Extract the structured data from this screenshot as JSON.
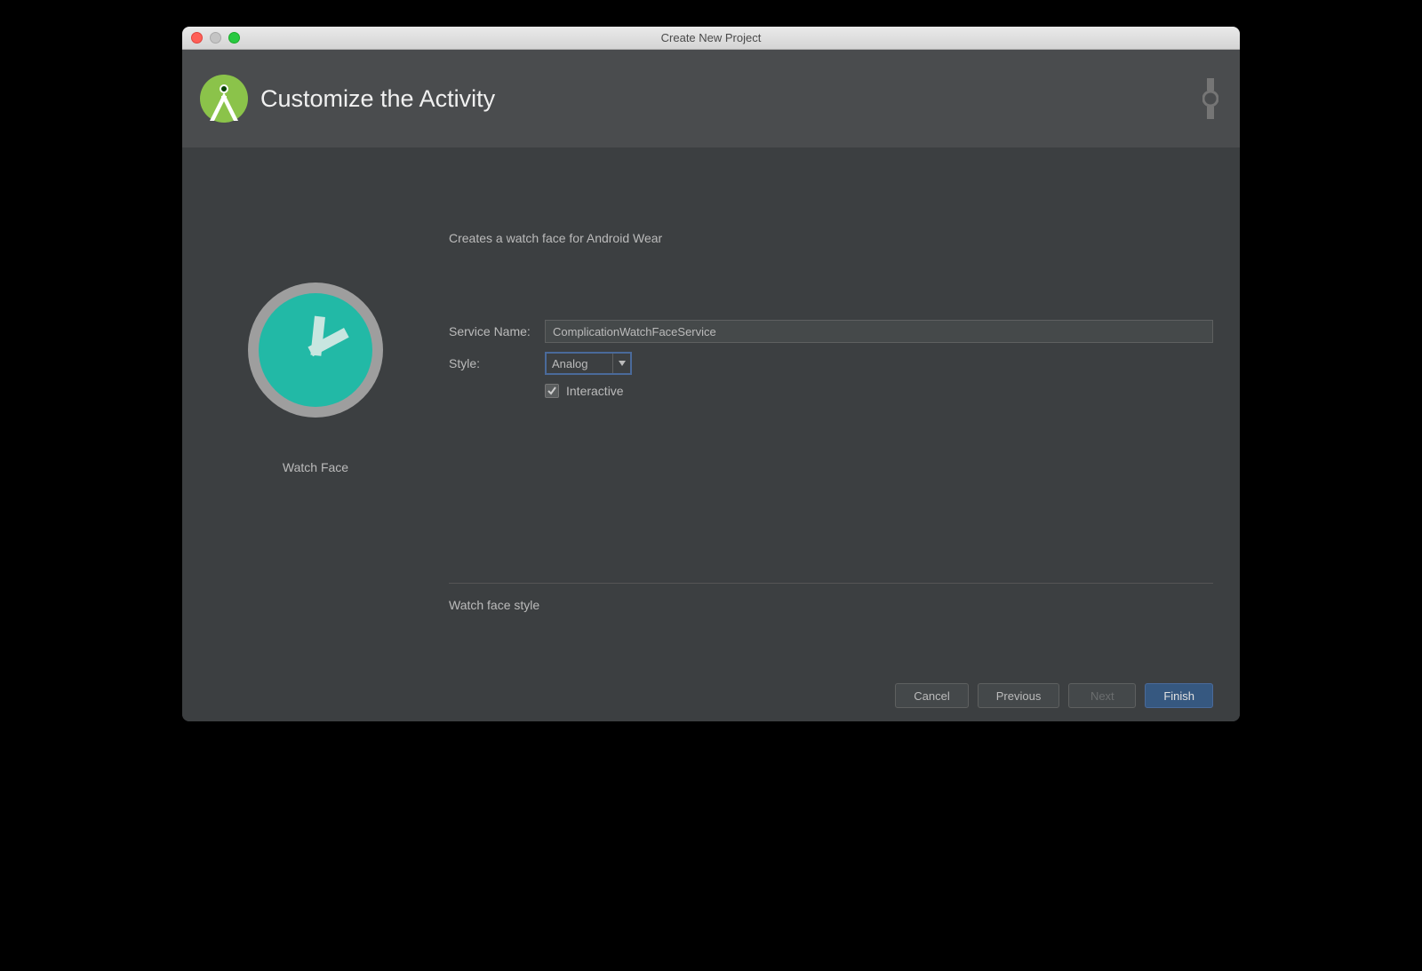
{
  "window": {
    "title": "Create New Project"
  },
  "header": {
    "title": "Customize the Activity"
  },
  "preview": {
    "label": "Watch Face"
  },
  "form": {
    "description": "Creates a watch face for Android Wear",
    "service_name_label": "Service Name:",
    "service_name_value": "ComplicationWatchFaceService",
    "style_label": "Style:",
    "style_value": "Analog",
    "interactive_label": "Interactive",
    "interactive_checked": true,
    "help_text": "Watch face style"
  },
  "footer": {
    "cancel": "Cancel",
    "previous": "Previous",
    "next": "Next",
    "finish": "Finish"
  }
}
